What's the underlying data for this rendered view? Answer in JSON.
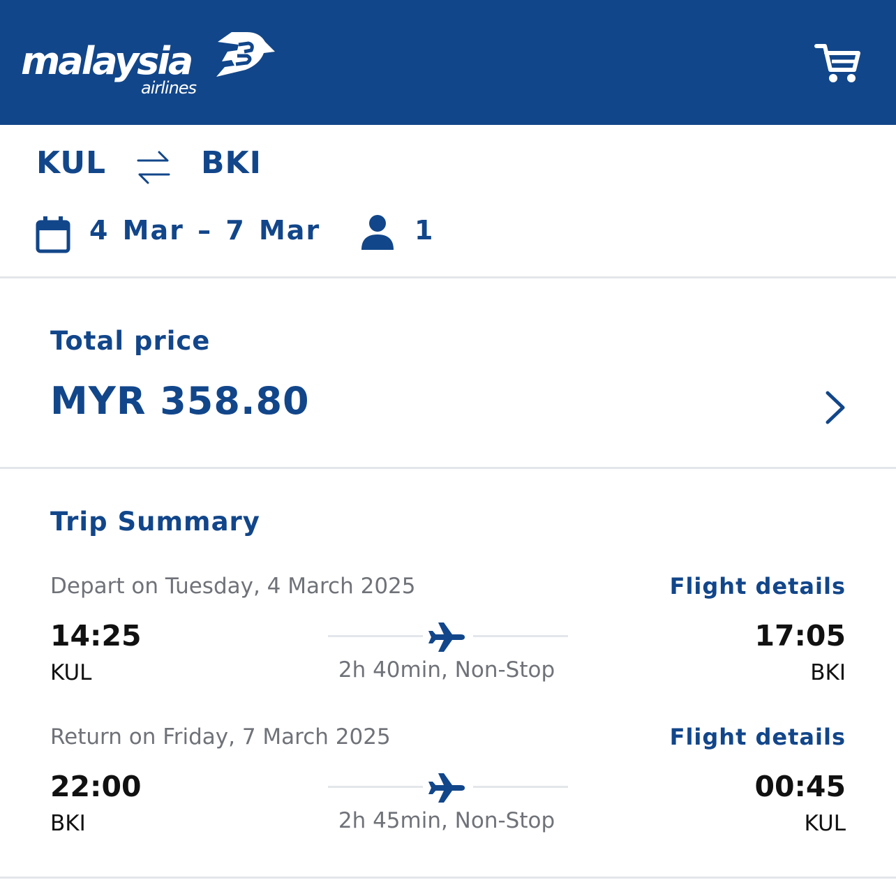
{
  "header": {
    "logo_text": "malaysia",
    "logo_sub": "airlines",
    "cart_icon": "cart-icon",
    "background": "#12468a"
  },
  "search": {
    "origin": "KUL",
    "destination": "BKI",
    "swap_icon": "swap-arrows-icon",
    "calendar_icon": "calendar-icon",
    "dates": "4 Mar – 7 Mar",
    "passenger_icon": "person-icon",
    "passengers": "1"
  },
  "price": {
    "label": "Total price",
    "value": "MYR 358.80",
    "chevron_icon": "chevron-right-icon"
  },
  "summary": {
    "title": "Trip Summary",
    "legs": [
      {
        "date": "Depart on Tuesday, 4 March 2025",
        "details_label": "Flight details",
        "dep_time": "14:25",
        "dep_airport": "KUL",
        "arr_time": "17:05",
        "arr_airport": "BKI",
        "info": "2h 40min, Non-Stop"
      },
      {
        "date": "Return on Friday, 7 March 2025",
        "details_label": "Flight details",
        "dep_time": "22:00",
        "dep_airport": "BKI",
        "arr_time": "00:45",
        "arr_airport": "KUL",
        "info": "2h 45min, Non-Stop"
      }
    ]
  },
  "colors": {
    "brand": "#12468a",
    "muted_text": "#6f7278",
    "divider": "#e3e6ea"
  }
}
